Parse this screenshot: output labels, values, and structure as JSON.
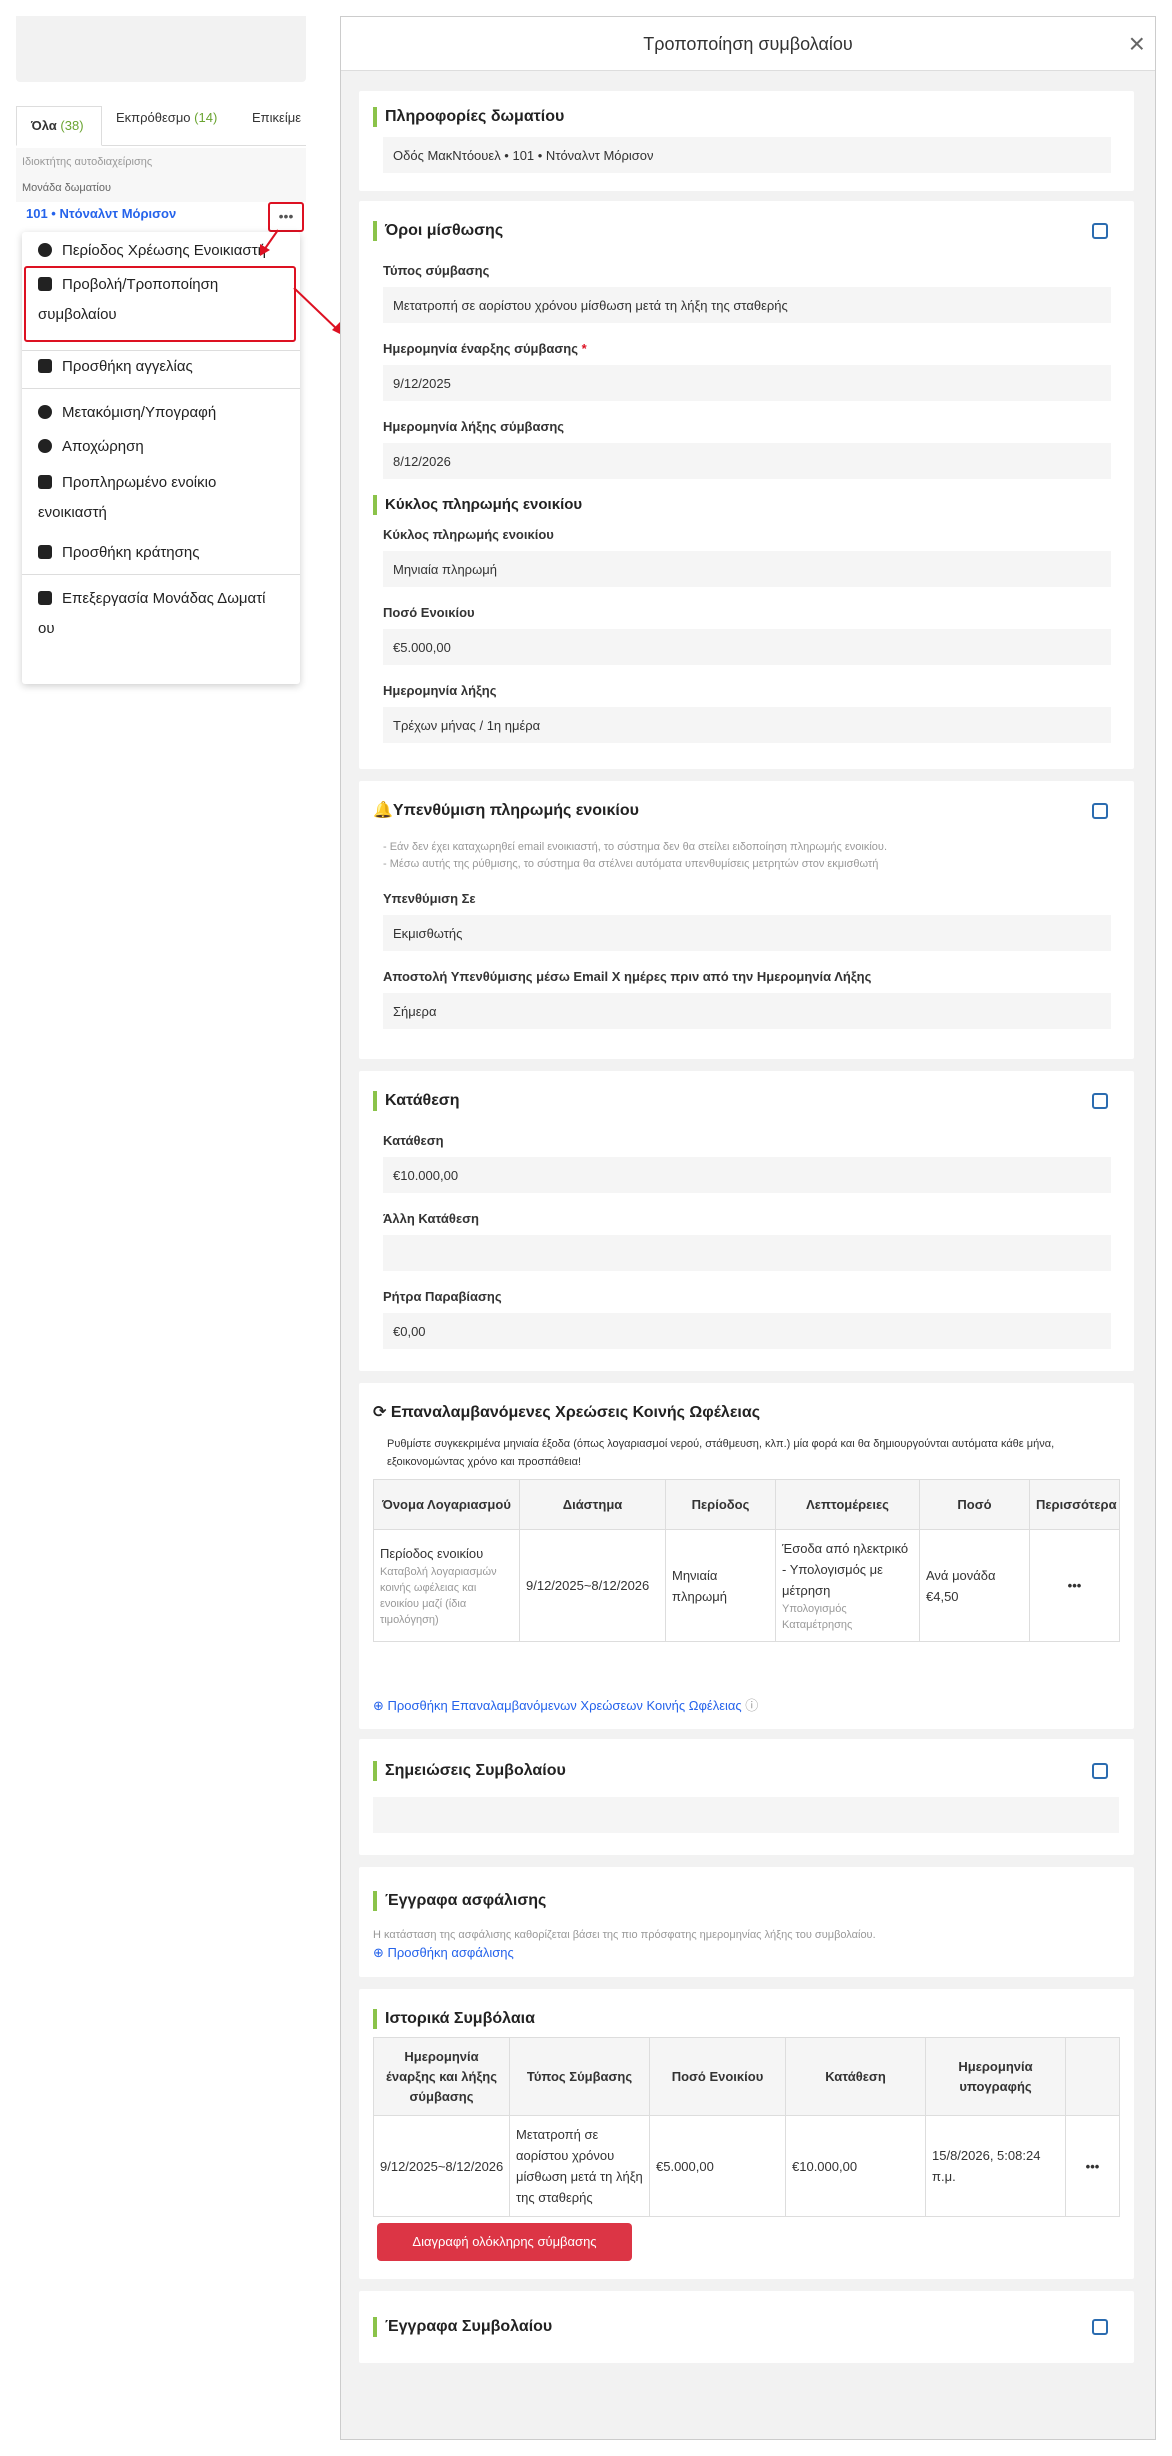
{
  "left": {
    "tabs": [
      {
        "label": "Όλα",
        "count": "(38)"
      },
      {
        "label": "Εκπρόθεσμο",
        "count": "(14)"
      },
      {
        "label": "Επικείμε",
        "count": ""
      }
    ],
    "row1": "Ιδιοκτήτης αυτοδιαχείρισης",
    "row2": "Μονάδα δωματίου",
    "unit": "101 • Ντόναλντ Μόρισον",
    "dots": "•••",
    "menu": [
      "Περίοδος Χρέωσης Ενοικιαστή",
      "Προβολή/Τροποποίηση",
      "συμβολαίου",
      "Προσθήκη αγγελίας",
      "Μετακόμιση/Υπογραφή",
      "Αποχώρηση",
      "Προπληρωμένο ενοίκιο",
      "ενοικιαστή",
      "Προσθήκη κράτησης",
      "Επεξεργασία Μονάδας Δωματί",
      "ου"
    ]
  },
  "panel": {
    "title": "Τροποποίηση συμβολαίου",
    "room": {
      "heading": "Πληροφορίες δωματίου",
      "value": "Οδός ΜακΝτόουελ • 101 • Ντόναλντ Μόρισον"
    },
    "lease": {
      "heading": "Όροι μίσθωσης",
      "type_label": "Τύπος σύμβασης",
      "type_value": "Μετατροπή σε αορίστου χρόνου μίσθωση μετά τη λήξη της σταθερής",
      "start_label": "Ημερομηνία έναρξης σύμβασης",
      "required": "*",
      "start_value": "9/12/2025",
      "end_label": "Ημερομηνία λήξης σύμβασης",
      "end_value": "8/12/2026",
      "cycle_heading": "Κύκλος πληρωμής ενοικίου",
      "cycle_label": "Κύκλος πληρωμής ενοικίου",
      "cycle_value": "Μηνιαία πληρωμή",
      "rent_label": "Ποσό Ενοικίου",
      "rent_value": "€5.000,00",
      "due_label": "Ημερομηνία λήξης",
      "due_value": "Τρέχων μήνας / 1η ημέρα"
    },
    "reminder": {
      "heading": "Υπενθύμιση πληρωμής ενοικίου",
      "note1": "- Εάν δεν έχει καταχωρηθεί email ενοικιαστή, το σύστημα δεν θα στείλει ειδοποίηση πληρωμής ενοικίου.",
      "note2": "- Μέσω αυτής της ρύθμισης, το σύστημα θα στέλνει αυτόματα υπενθυμίσεις μετρητών στον εκμισθωτή",
      "to_label": "Υπενθύμιση Σε",
      "to_value": "Εκμισθωτής",
      "days_label": "Αποστολή Υπενθύμισης μέσω Email X ημέρες πριν από την Ημερομηνία Λήξης",
      "days_value": "Σήμερα"
    },
    "deposit": {
      "heading": "Κατάθεση",
      "dep_label": "Κατάθεση",
      "dep_value": "€10.000,00",
      "other_label": "Άλλη Κατάθεση",
      "other_value": "",
      "penalty_label": "Ρήτρα Παραβίασης",
      "penalty_value": "€0,00"
    },
    "utilities": {
      "heading": "Επαναλαμβανόμενες Χρεώσεις Κοινής Ωφέλειας",
      "desc": "Ρυθμίστε συγκεκριμένα μηνιαία έξοδα (όπως λογαριασμοί νερού, στάθμευση, κλπ.) μία φορά και θα δημιουργούνται αυτόματα κάθε μήνα, εξοικονομώντας χρόνο και προσπάθεια!",
      "headers": [
        "Όνομα Λογαριασμού",
        "Διάστημα",
        "Περίοδος",
        "Λεπτομέρειες",
        "Ποσό",
        "Περισσότερα"
      ],
      "row": {
        "name": "Περίοδος ενοικίου",
        "name_sub": "Καταβολή λογαριασμών κοινής ωφέλειας και ενοικίου μαζί (ίδια τιμολόγηση)",
        "range": "9/12/2025~8/12/2026",
        "period": "Μηνιαία πληρωμή",
        "details": "Έσοδα από ηλεκτρικό - Υπολογισμός με μέτρηση",
        "details_sub": "Υπολογισμός Καταμέτρησης",
        "amount": "Ανά μονάδα €4,50",
        "more": "•••"
      },
      "add_link": "Προσθήκη Επαναλαμβανόμενων Χρεώσεων Κοινής Ωφέλειας"
    },
    "notes": {
      "heading": "Σημειώσεις Συμβολαίου",
      "value": ""
    },
    "insurance": {
      "heading": "Έγγραφα ασφάλισης",
      "note": "Η κατάσταση της ασφάλισης καθορίζεται βάσει της πιο πρόσφατης ημερομηνίας λήξης του συμβολαίου.",
      "add_link": "Προσθήκη ασφάλισης"
    },
    "history": {
      "heading": "Ιστορικά Συμβόλαια",
      "headers": [
        "Ημερομηνία έναρξης και λήξης σύμβασης",
        "Τύπος Σύμβασης",
        "Ποσό Ενοικίου",
        "Κατάθεση",
        "Ημερομηνία υπογραφής",
        ""
      ],
      "row": {
        "dates": "9/12/2025~8/12/2026",
        "type": "Μετατροπή σε αορίστου χρόνου μίσθωση μετά τη λήξη της σταθερής",
        "rent": "€5.000,00",
        "deposit": "€10.000,00",
        "signed": "15/8/2026, 5:08:24 π.μ.",
        "more": "•••"
      },
      "delete_button": "Διαγραφή ολόκληρης σύμβασης"
    },
    "docs": {
      "heading": "Έγγραφα Συμβολαίου"
    }
  }
}
